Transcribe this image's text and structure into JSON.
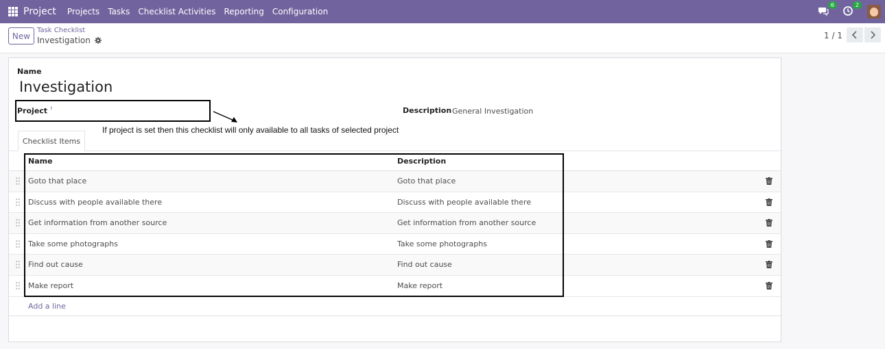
{
  "navbar": {
    "app_name": "Project",
    "menu": [
      "Projects",
      "Tasks",
      "Checklist Activities",
      "Reporting",
      "Configuration"
    ],
    "messages_badge": "6",
    "activities_badge": "2",
    "color": "#71639e"
  },
  "control_panel": {
    "new_label": "New",
    "breadcrumb": "Task Checklist",
    "record_name": "Investigation",
    "pager": "1 / 1"
  },
  "form": {
    "name_label": "Name",
    "name_value": "Investigation",
    "project_label": "Project",
    "project_help": "?",
    "description_label": "Description",
    "description_value": "General Investigation",
    "annotation": "If project is set then this checklist will only available to all tasks of selected project",
    "tab_label": "Checklist Items",
    "columns": [
      "Name",
      "Description"
    ],
    "rows": [
      {
        "name": "Goto that place",
        "description": "Goto that place"
      },
      {
        "name": "Discuss with people available there",
        "description": "Discuss with people available there"
      },
      {
        "name": "Get information from another source",
        "description": "Get information from another source"
      },
      {
        "name": "Take some photographs",
        "description": "Take some photographs"
      },
      {
        "name": "Find out cause",
        "description": "Find out cause"
      },
      {
        "name": "Make report",
        "description": "Make report"
      }
    ],
    "add_line": "Add a line"
  }
}
